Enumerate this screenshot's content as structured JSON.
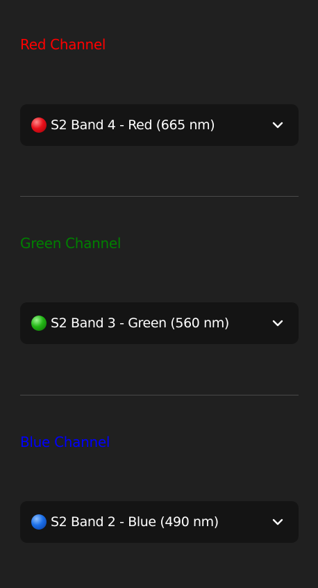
{
  "channels": [
    {
      "label": "Red Channel",
      "label_color": "#ff0000",
      "selected": "S2 Band 4 - Red (665 nm)",
      "dot_color": "#e8101a",
      "dot_icon": "red-circle-icon"
    },
    {
      "label": "Green Channel",
      "label_color": "#008000",
      "selected": "S2 Band 3 - Green (560 nm)",
      "dot_color": "#22b515",
      "dot_icon": "green-circle-icon"
    },
    {
      "label": "Blue Channel",
      "label_color": "#0000ff",
      "selected": "S2 Band 2 - Blue (490 nm)",
      "dot_color": "#1a6ee8",
      "dot_icon": "blue-circle-icon"
    }
  ],
  "colors": {
    "background": "#202020",
    "select_background": "#141414",
    "divider": "#4a4a4a",
    "text": "#ffffff"
  }
}
